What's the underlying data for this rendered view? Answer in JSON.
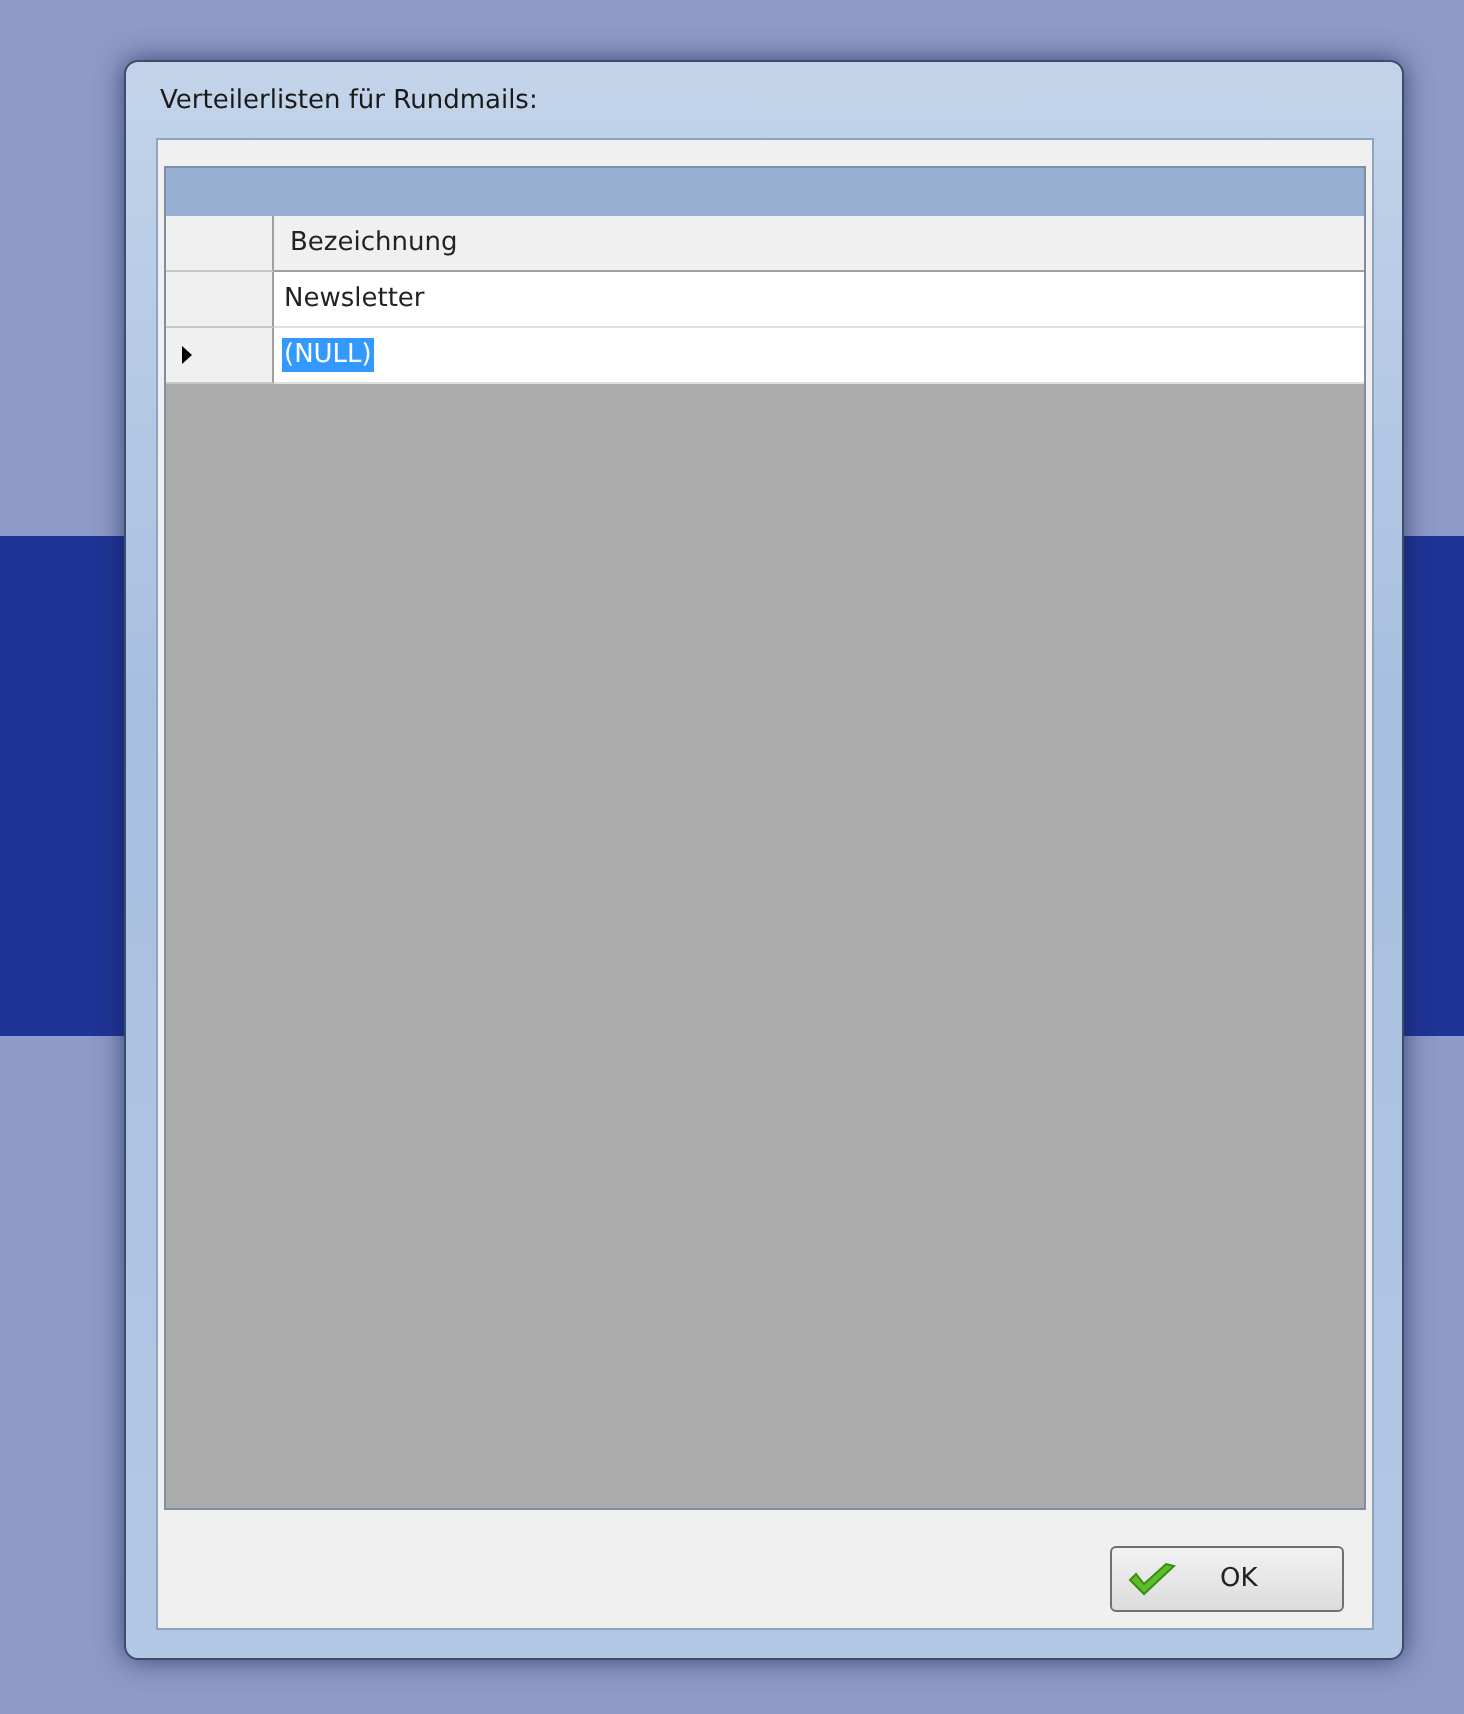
{
  "window": {
    "title": "Verteilerlisten für Rundmails:"
  },
  "table": {
    "columns": [
      "Bezeichnung"
    ],
    "rows": [
      {
        "cells": [
          "Newsletter"
        ],
        "selected": false
      },
      {
        "cells": [
          "(NULL)"
        ],
        "selected": true
      }
    ]
  },
  "buttons": [
    {
      "label": "OK",
      "kind": "ok"
    }
  ]
}
